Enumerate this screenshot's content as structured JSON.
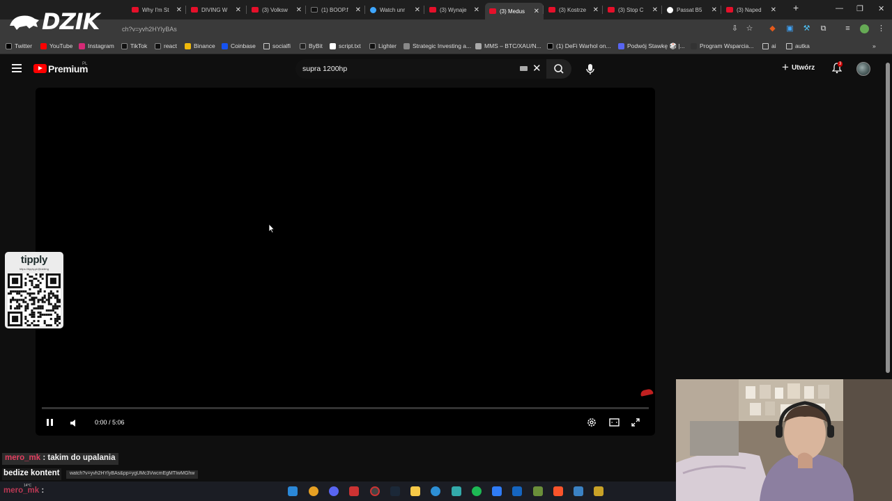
{
  "overlay": {
    "brand": "DZIK"
  },
  "browser": {
    "tabs": [
      {
        "title": "Why I'm St",
        "icon": "yt"
      },
      {
        "title": "DIVING W",
        "icon": "yt"
      },
      {
        "title": "(3) Volksw",
        "icon": "yt"
      },
      {
        "title": "(1) BOOP.f",
        "icon": "x"
      },
      {
        "title": "Watch unr",
        "icon": "w"
      },
      {
        "title": "(3) Wynaje",
        "icon": "yt"
      },
      {
        "title": "(3) Medus",
        "icon": "yt",
        "active": true
      },
      {
        "title": "(3) Kostrze",
        "icon": "yt"
      },
      {
        "title": "(3) Stop C",
        "icon": "yt"
      },
      {
        "title": "Passat B5",
        "icon": "gh"
      },
      {
        "title": "(3) Naped",
        "icon": "yt"
      }
    ],
    "new_tab": "+",
    "window_controls": {
      "minimize": "—",
      "restore": "❐",
      "close": "✕"
    },
    "url_fragment": "ch?v=yvh2HYlyBAs",
    "bookmarks": [
      {
        "label": "Twitter",
        "color": "#000000"
      },
      {
        "label": "YouTube",
        "color": "#ff0000"
      },
      {
        "label": "Instagram",
        "color": "#d62976"
      },
      {
        "label": "TikTok",
        "color": "#111111"
      },
      {
        "label": "react",
        "color": "#111111"
      },
      {
        "label": "Binance",
        "color": "#f0b90b"
      },
      {
        "label": "Coinbase",
        "color": "#1652f0"
      },
      {
        "label": "socialfi",
        "color": "folder"
      },
      {
        "label": "ByBit",
        "color": "#222222"
      },
      {
        "label": "script.txt",
        "color": "#ffffff"
      },
      {
        "label": "Lighter",
        "color": "#111111"
      },
      {
        "label": "Strategic Investing a...",
        "color": "#888888"
      },
      {
        "label": "MMS – BTC/XAU/N...",
        "color": "#aaaaaa"
      },
      {
        "label": "(1) DeFi Warhol on...",
        "color": "#000000"
      },
      {
        "label": "Podwój Stawkę 🎲 |...",
        "color": "#5865f2"
      },
      {
        "label": "Program Wsparcia...",
        "color": "#333333"
      },
      {
        "label": "ai",
        "color": "folder"
      },
      {
        "label": "autka",
        "color": "folder"
      }
    ],
    "bookmarks_more": "»"
  },
  "youtube": {
    "logo_text": "Premium",
    "country_code": "PL",
    "search_value": "supra 1200hp",
    "create_label": "Utwórz",
    "notification_count": "3",
    "player": {
      "time": "0:00 / 5:06",
      "progress": 0
    }
  },
  "tipply": {
    "title": "tipply",
    "url": "https://tipply.pl/@dzikhg"
  },
  "chat": [
    {
      "user": "mero_mk",
      "text": ": takim do upalania"
    },
    {
      "user": "",
      "text": "bedize kontent"
    },
    {
      "user": "mero_mk",
      "text": ":"
    }
  ],
  "status_bar_url": "watch?v=yvh2HYlyBAs&pp=ygUMc3VwcmEgMTIwMGhw",
  "taskbar": {
    "weather": "14°C"
  }
}
